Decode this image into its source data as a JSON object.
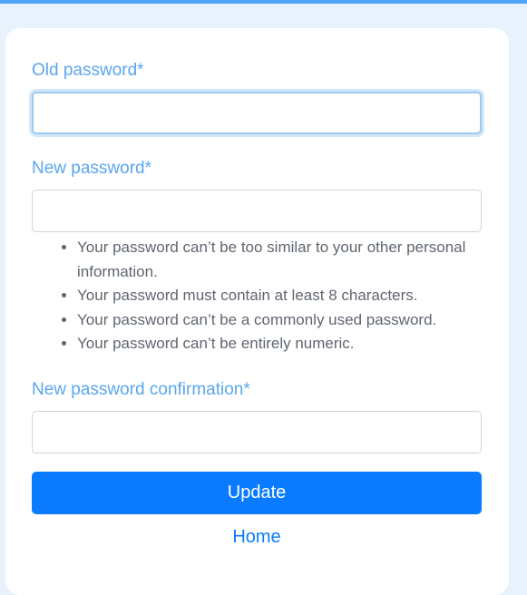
{
  "form": {
    "old_password": {
      "label": "Old password*",
      "value": ""
    },
    "new_password": {
      "label": "New password*",
      "value": "",
      "help_items": [
        "Your password can’t be too similar to your other personal information.",
        "Your password must contain at least 8 characters.",
        "Your password can’t be a commonly used password.",
        "Your password can’t be entirely numeric."
      ]
    },
    "confirmation": {
      "label": "New password confirmation*",
      "value": ""
    },
    "submit_label": "Update",
    "home_link": "Home"
  },
  "colors": {
    "page_background": "#e8f2fc",
    "top_bar": "#4da3f5",
    "label": "#5aa6ef",
    "primary": "#0a7bff",
    "help_text": "#5f6670"
  }
}
